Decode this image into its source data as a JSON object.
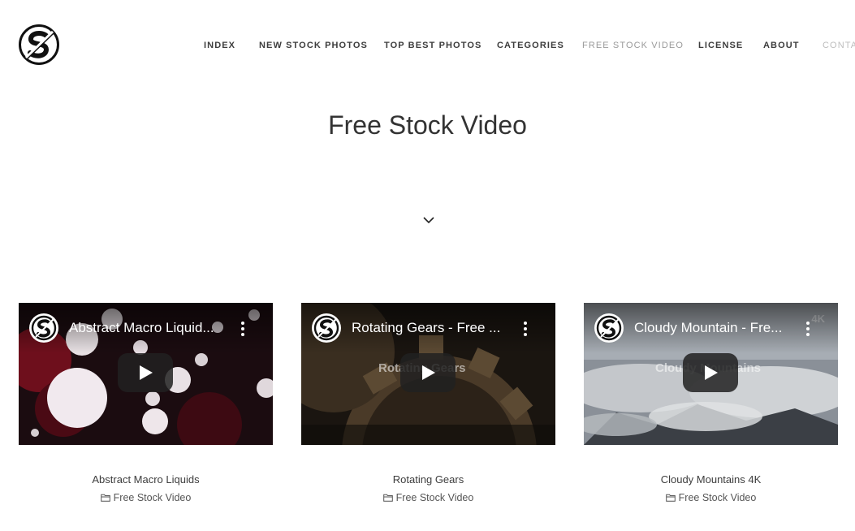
{
  "logo": {
    "alt": "Stock Snap logo",
    "icon": "s-circle-logo-icon"
  },
  "nav": {
    "items": [
      {
        "label": "INDEX"
      },
      {
        "label": "NEW STOCK PHOTOS"
      },
      {
        "label": "TOP BEST PHOTOS"
      },
      {
        "label": "CATEGORIES"
      },
      {
        "label": "FREE STOCK VIDEO",
        "active": true
      },
      {
        "label": "LICENSE"
      },
      {
        "label": "ABOUT"
      },
      {
        "label": "CONTA"
      }
    ]
  },
  "page": {
    "title": "Free Stock Video"
  },
  "scroll_icon": "chevron-down-icon",
  "videos": [
    {
      "overlay_title": "Abstract Macro Liquid...",
      "title": "Abstract Macro Liquids",
      "category": "Free Stock Video"
    },
    {
      "overlay_title": "Rotating Gears - Free ...",
      "title": "Rotating Gears",
      "category": "Free Stock Video",
      "watermark": "Rotating Gears"
    },
    {
      "overlay_title": "Cloudy Mountain - Fre...",
      "title": "Cloudy Mountains 4K",
      "category": "Free Stock Video",
      "watermark": "Cloudy Mountains",
      "badge": "4K"
    }
  ],
  "colors": {
    "accent_active": "#9a9a9a",
    "text": "#333333",
    "play_button": "#212121"
  }
}
